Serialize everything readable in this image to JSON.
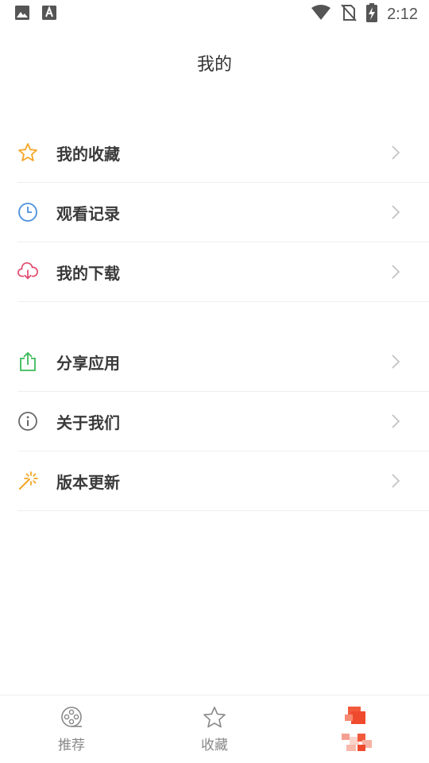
{
  "status_bar": {
    "time": "2:12",
    "left_icons": [
      "image-icon",
      "font-icon"
    ],
    "right_icons": [
      "wifi-icon",
      "no-sim-icon",
      "battery-charging-icon"
    ]
  },
  "header": {
    "title": "我的"
  },
  "menu": {
    "group1": [
      {
        "label": "我的收藏",
        "icon": "star-icon",
        "color": "#f5a623"
      },
      {
        "label": "观看记录",
        "icon": "clock-icon",
        "color": "#4a90d9"
      },
      {
        "label": "我的下载",
        "icon": "cloud-download-icon",
        "color": "#e2476b"
      }
    ],
    "group2": [
      {
        "label": "分享应用",
        "icon": "share-icon",
        "color": "#3dba5a"
      },
      {
        "label": "关于我们",
        "icon": "info-icon",
        "color": "#666666"
      },
      {
        "label": "版本更新",
        "icon": "magic-wand-icon",
        "color": "#f5a623"
      }
    ]
  },
  "tab_bar": {
    "tabs": [
      {
        "label": "推荐",
        "icon": "film-reel-icon"
      },
      {
        "label": "收藏",
        "icon": "star-outline-icon"
      },
      {
        "label": "",
        "icon": "avatar"
      }
    ]
  }
}
